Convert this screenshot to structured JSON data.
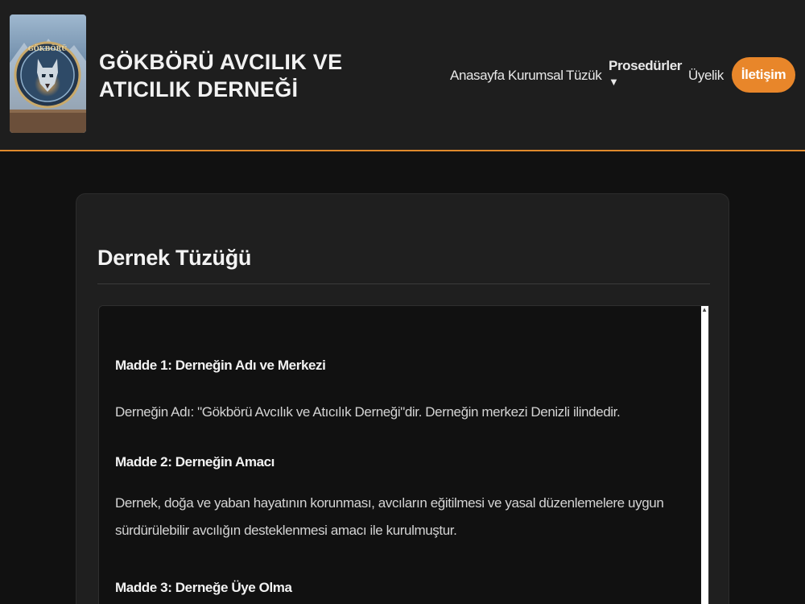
{
  "header": {
    "site_title": "GÖKBÖRÜ AVCILIK VE ATICILIK DERNEĞİ",
    "logo_text": "GÖKBÖRÜ",
    "accent_color": "#e8862a"
  },
  "nav": {
    "items": [
      {
        "label": "Anasayfa"
      },
      {
        "label": "Kurumsal"
      },
      {
        "label": "Tüzük"
      },
      {
        "label": "Prosedürler",
        "arrow": "▼"
      },
      {
        "label": "Üyelik"
      }
    ],
    "contact_label": "İletişim"
  },
  "main": {
    "title": "Dernek Tüzüğü",
    "articles": [
      {
        "heading": "Madde 1: Derneğin Adı ve Merkezi",
        "body": "Derneğin Adı: \"Gökbörü Avcılık ve Atıcılık Derneği\"dir. Derneğin merkezi Denizli ilindedir."
      },
      {
        "heading": "Madde 2: Derneğin Amacı",
        "body": "Dernek, doğa ve yaban hayatının korunması, avcıların eğitilmesi ve yasal düzenlemelere uygun sürdürülebilir avcılığın desteklenmesi amacı ile kurulmuştur."
      },
      {
        "heading": "Madde 3: Derneğe Üye Olma"
      }
    ]
  }
}
